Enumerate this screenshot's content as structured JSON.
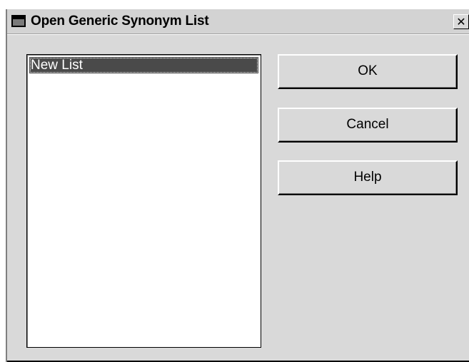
{
  "dialog": {
    "title": "Open Generic Synonym List",
    "title_icon": "window-menu-icon",
    "close_symbol": "✕"
  },
  "list": {
    "items": [
      {
        "label": "New List",
        "selected": true
      }
    ]
  },
  "buttons": {
    "ok_label": "OK",
    "cancel_label": "Cancel",
    "help_label": "Help"
  },
  "colors": {
    "face": "#d9d9d9",
    "selection": "#4a4a4a",
    "list_background": "#ffffff"
  }
}
